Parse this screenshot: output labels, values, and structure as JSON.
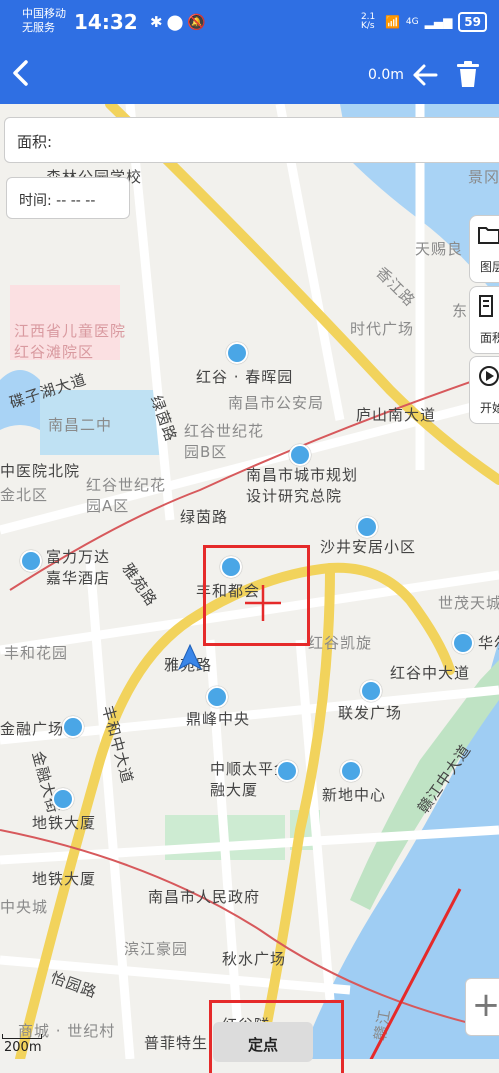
{
  "status_bar": {
    "carrier_line1": "中国移动",
    "carrier_line2": "无服务",
    "time": "14:32",
    "net_speed": "2.1 K/s",
    "network": "4G",
    "battery": "59"
  },
  "toolbar": {
    "distance": "0.0m"
  },
  "panel": {
    "area_label": "面积:",
    "time_label": "时间: -- -- --"
  },
  "side_buttons": {
    "layers": "图层",
    "area": "面积",
    "start": "开始"
  },
  "map_labels": {
    "school": "森林公园学校",
    "jing": "景冈",
    "tianci": "天赐良",
    "road_dongjiang": "香江路",
    "dong": "东",
    "shidai": "时代广场",
    "children_hospital": "江西省儿童医院红谷滩院区",
    "dieziruhu": "碟子湖大道",
    "nanchang2": "南昌二中",
    "lvyin_road_v": "绿茵路",
    "hongcha": "红谷 · 春晖园",
    "police": "南昌市公安局",
    "lushan": "庐山南大道",
    "hongguhuayuanB": "红谷世纪花园B区",
    "zhongyiyuan": "中医院北院",
    "hongguhuayuanA": "红谷世纪花园A区",
    "shangbei": "金北区",
    "planning": "南昌市城市规划设计研究总院",
    "lvyin_road": "绿茵路",
    "shajing": "沙井安居小区",
    "fuli": "富力万达嘉华酒店",
    "yayuan_road": "雅苑路",
    "fenghe": "丰和都会",
    "shimao": "世茂天城",
    "fenghua": "丰和花园",
    "honggu_kaixuan": "红谷凯旋",
    "huaxia": "华尔",
    "yazhu": "雅苑路",
    "honggu_dadao": "红谷中大道",
    "fenghe_dadao": "丰和中大道",
    "jinrong_plaza": "金融广场",
    "dingfeng": "鼎峰中央",
    "lianfa": "联发广场",
    "jinrong_street": "金融大街",
    "zhongshun": "中顺太平金融大厦",
    "ganjiang": "赣江中大道",
    "metro_building": "地铁大厦",
    "xindi": "新地中心",
    "metro_building2": "地铁大厦",
    "central_city": "中央城",
    "gov": "南昌市人民政府",
    "binjiang": "滨江豪园",
    "qiushui": "秋水广场",
    "yiyuan": "怡园路",
    "shangcheng": "商城 · 世纪村",
    "pufei": "普菲特生",
    "honggu_bottom": "红谷隧",
    "gan": "赣江"
  },
  "controls": {
    "zoom_in": "+",
    "fix_point": "定点",
    "scale": "200m"
  }
}
